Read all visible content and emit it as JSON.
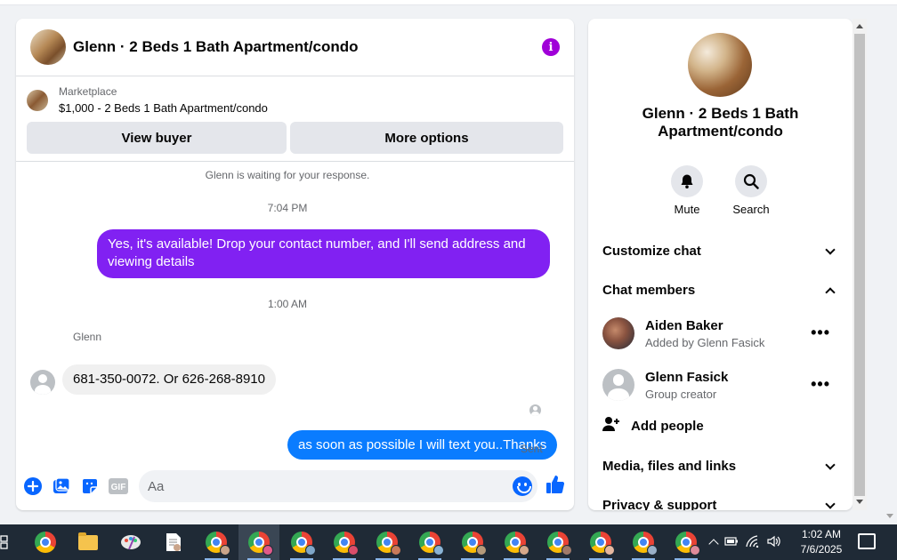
{
  "chat": {
    "title": "Glenn · 2 Beds 1 Bath Apartment/condo",
    "listing": {
      "label": "Marketplace",
      "price_title": "$1,000 - 2 Beds 1 Bath Apartment/condo",
      "view_buyer": "View buyer",
      "more_options": "More options"
    },
    "messages": {
      "waiting": "Glenn is waiting for your response.",
      "time1": "7:04 PM",
      "out1": "Yes, it's available! Drop your contact number, and I'll send address and viewing details",
      "time2": "1:00 AM",
      "sender": "Glenn",
      "in1": "681-350-0072. Or 626-268-8910",
      "out2": "as soon as possible I will text you..Thanks",
      "status": "Sent"
    },
    "composer": {
      "placeholder": "Aa",
      "gif": "GIF"
    }
  },
  "side": {
    "title": "Glenn · 2 Beds 1 Bath Apartment/condo",
    "mute": "Mute",
    "search": "Search",
    "customize": "Customize chat",
    "members_header": "Chat members",
    "members": [
      {
        "name": "Aiden Baker",
        "sub": "Added by Glenn Fasick"
      },
      {
        "name": "Glenn Fasick",
        "sub": "Group creator"
      }
    ],
    "add_people": "Add people",
    "media": "Media, files and links",
    "privacy": "Privacy & support"
  },
  "taskbar": {
    "time": "1:02 AM",
    "date": "7/6/2025"
  },
  "colors": {
    "accent_purple": "#8121f2",
    "accent_blue": "#0a7cff",
    "info_purple": "#a000d8",
    "icon_blue": "#0866ff"
  }
}
